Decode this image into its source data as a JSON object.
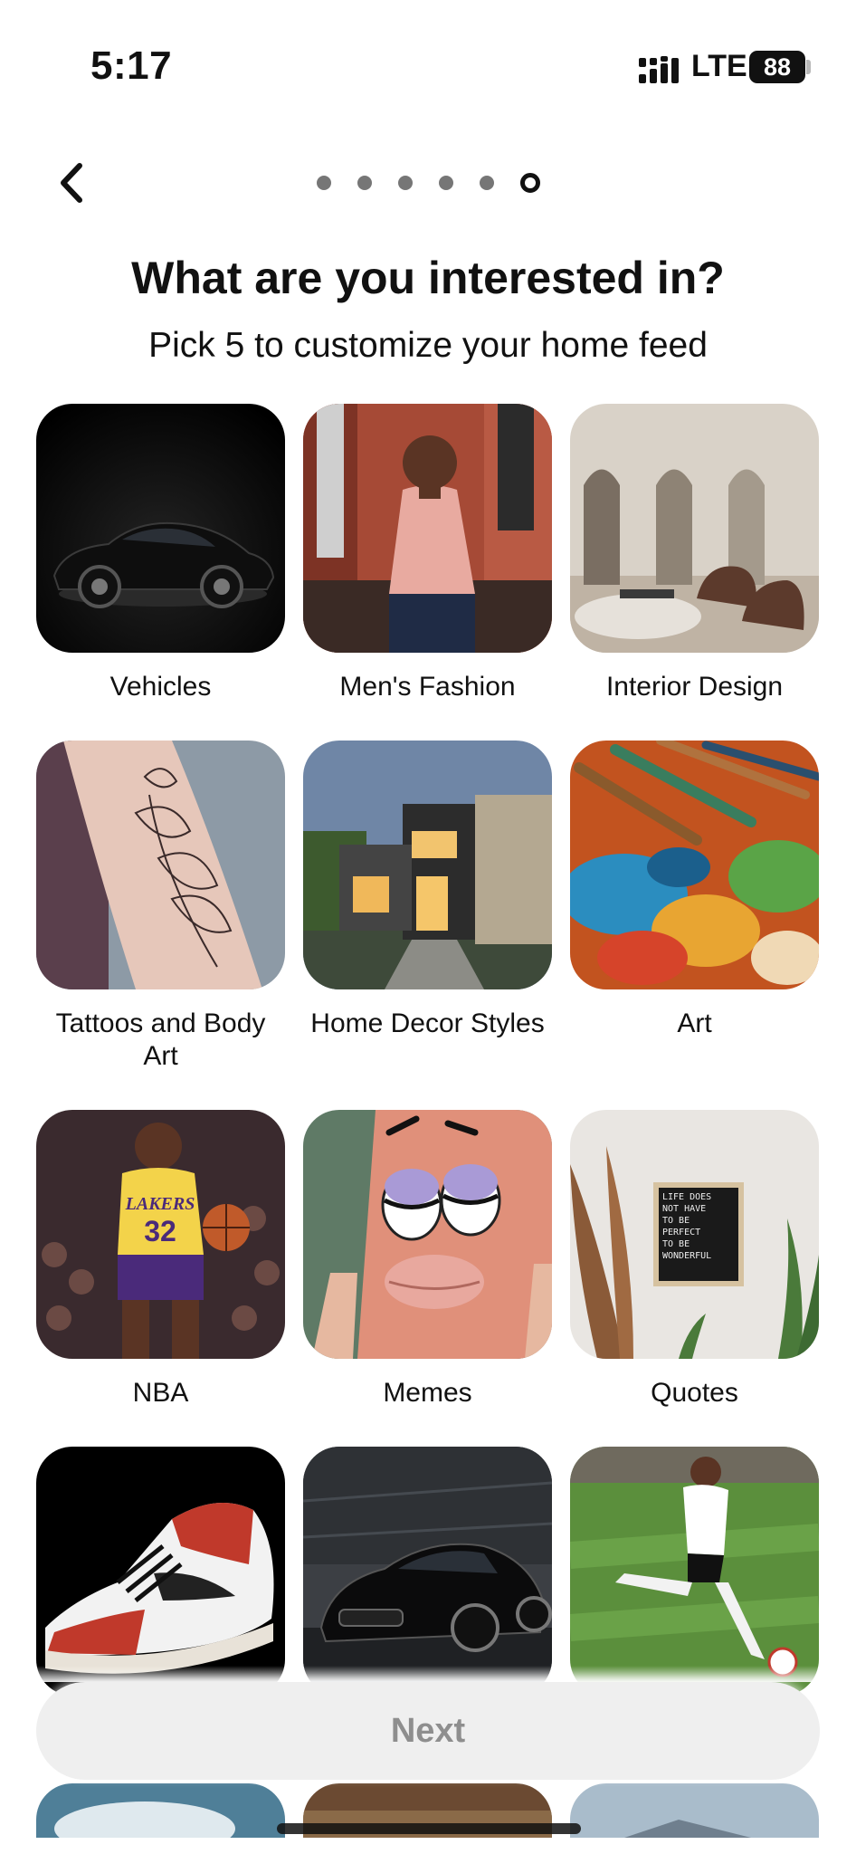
{
  "status_bar": {
    "time": "5:17",
    "network": "LTE",
    "battery": "88"
  },
  "header": {
    "back_icon": "chevron-left-icon",
    "progress": {
      "total_steps": 6,
      "current_step": 6
    }
  },
  "title": "What are you interested in?",
  "subtitle": "Pick 5 to customize your home feed",
  "topics": [
    {
      "label": "Vehicles"
    },
    {
      "label": "Men's Fashion"
    },
    {
      "label": "Interior Design"
    },
    {
      "label": "Tattoos and Body Art"
    },
    {
      "label": "Home Decor Styles"
    },
    {
      "label": "Art"
    },
    {
      "label": "NBA"
    },
    {
      "label": "Memes"
    },
    {
      "label": "Quotes"
    }
  ],
  "quote_card": {
    "text": "LIFE DOES NOT HAVE TO BE PERFECT TO BE WONDERFUL"
  },
  "jersey": {
    "text": "LAKERS",
    "number": "32"
  },
  "next_button": {
    "label": "Next"
  },
  "colors": {
    "text": "#111111",
    "next_bg": "#efefef",
    "next_text": "#8e8e8e",
    "dot_inactive": "#767676"
  }
}
